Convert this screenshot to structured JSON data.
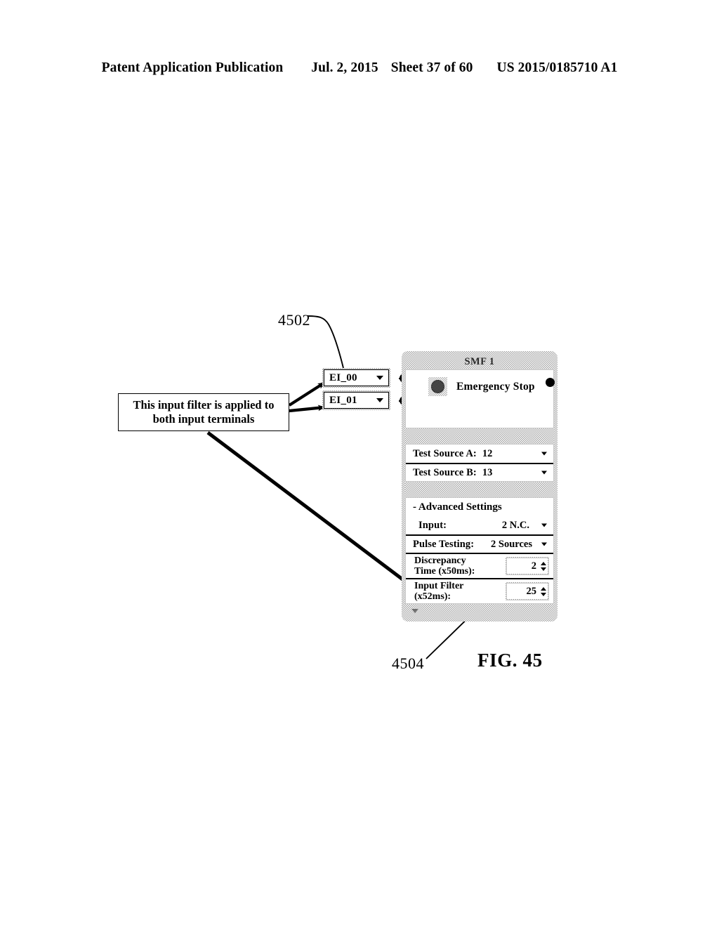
{
  "header": {
    "publication": "Patent Application Publication",
    "date": "Jul. 2, 2015",
    "sheet": "Sheet 37 of 60",
    "patent_number": "US 2015/0185710 A1"
  },
  "figure": {
    "label": "FIG. 45",
    "reference_numerals": [
      {
        "id": "4502",
        "text": "4502",
        "points_to": "EI_00 terminal dropdown"
      },
      {
        "id": "4504",
        "text": "4504",
        "points_to": "Input Filter spinner"
      }
    ],
    "callout": {
      "line1": "This input filter is applied to",
      "line2": "both input terminals"
    }
  },
  "terminals": [
    {
      "name": "EI_00",
      "label": "EI_00",
      "icon": "chevron-down-icon"
    },
    {
      "name": "EI_01",
      "label": "EI_01",
      "icon": "chevron-down-icon"
    }
  ],
  "panel": {
    "title": "SMF 1",
    "function_block": {
      "label": "Emergency Stop",
      "icon": "estop-button-icon"
    },
    "test_sources": [
      {
        "label": "Test Source A:",
        "value": "12",
        "icon": "chevron-down-icon"
      },
      {
        "label": "Test Source B:",
        "value": "13",
        "icon": "chevron-down-icon"
      }
    ],
    "advanced": {
      "header": "- Advanced Settings",
      "rows": [
        {
          "label": "Input:",
          "value": "2 N.C.",
          "icon": "chevron-down-icon"
        },
        {
          "label": "Pulse Testing:",
          "value": "2 Sources",
          "icon": "chevron-down-icon"
        }
      ],
      "steppers": [
        {
          "label": "Discrepancy\nTime (x50ms):",
          "value": "2"
        },
        {
          "label": "Input Filter\n(x52ms):",
          "value": "25"
        }
      ]
    },
    "footer_icon": "collapse-chevron-icon"
  },
  "colors": {
    "ink": "#000000",
    "panel_hatch": "#a8a8a8",
    "page_background": "#ffffff"
  }
}
